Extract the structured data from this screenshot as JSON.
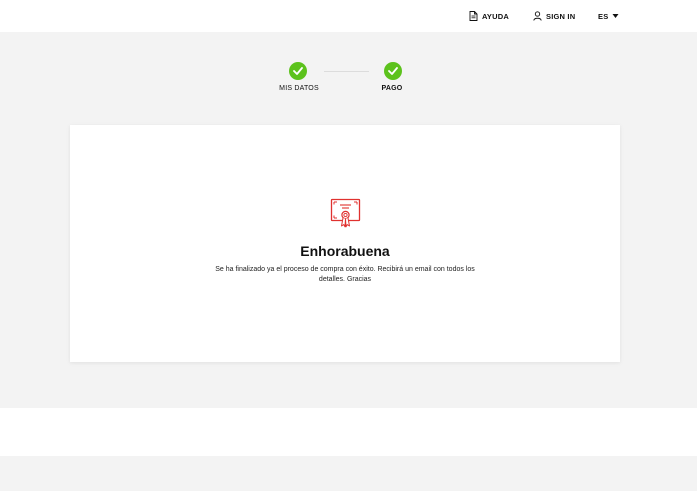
{
  "header": {
    "help_label": "AYUDA",
    "signin_label": "SIGN IN",
    "language_label": "ES",
    "icons": {
      "help": "document-icon",
      "signin": "user-icon",
      "language": "caret-down-icon"
    }
  },
  "stepper": {
    "steps": [
      {
        "label": "MIS DATOS",
        "completed": true
      },
      {
        "label": "PAGO",
        "completed": true
      }
    ]
  },
  "confirmation": {
    "icon": "certificate-icon",
    "title": "Enhorabuena",
    "message": "Se ha finalizado ya el proceso de compra con éxito. Recibirá un email con todos los detalles. Gracias"
  },
  "colors": {
    "step_complete": "#5cc21c",
    "icon_accent": "#e0312f",
    "page_background": "#f3f3f3",
    "surface": "#ffffff"
  }
}
